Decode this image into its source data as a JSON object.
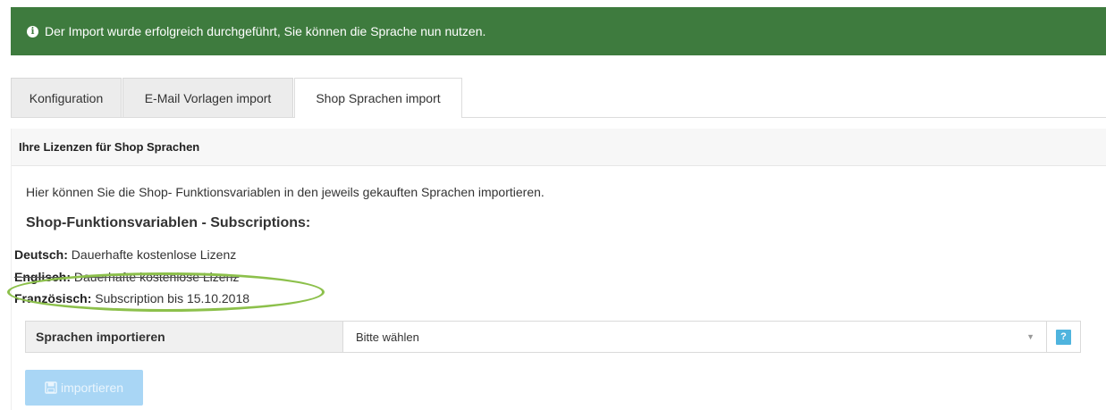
{
  "alert": {
    "icon": "info-icon",
    "message": "Der Import wurde erfolgreich durchgeführt, Sie können die Sprache nun nutzen."
  },
  "tabs": [
    {
      "label": "Konfiguration",
      "active": false
    },
    {
      "label": "E-Mail Vorlagen import",
      "active": false
    },
    {
      "label": "Shop Sprachen import",
      "active": true
    }
  ],
  "panel": {
    "title": "Ihre Lizenzen für Shop Sprachen",
    "description": "Hier können Sie die Shop- Funktionsvariablen in den jeweils gekauften Sprachen importieren.",
    "subheading": "Shop-Funktionsvariablen - Subscriptions:",
    "licenses": [
      {
        "lang": "Deutsch:",
        "status": "Dauerhafte kostenlose Lizenz"
      },
      {
        "lang": "Englisch:",
        "status": "Dauerhafte kostenlose Lizenz"
      },
      {
        "lang": "Französisch:",
        "status": "Subscription bis 15.10.2018"
      }
    ]
  },
  "form": {
    "label": "Sprachen importieren",
    "select_value": "Bitte wählen",
    "help_label": "?"
  },
  "button": {
    "label": "importieren",
    "icon": "save-icon"
  },
  "colors": {
    "alert_bg": "#3e7b3e",
    "highlight": "#8cc04b",
    "button_bg": "#a9d6f5",
    "help_bg": "#4fb4de"
  }
}
